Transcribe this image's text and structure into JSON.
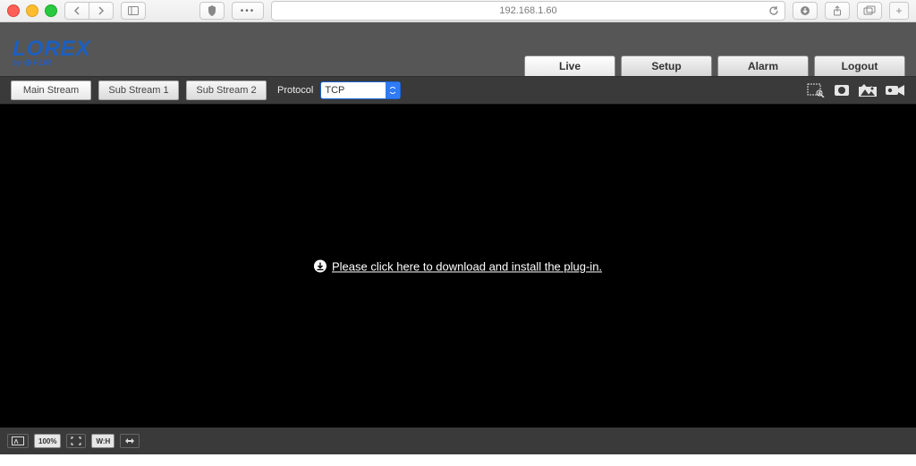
{
  "browser": {
    "url": "192.168.1.60"
  },
  "brand": {
    "name": "LOREX",
    "byline": "by",
    "sub": "FLIR"
  },
  "nav": {
    "live": "Live",
    "setup": "Setup",
    "alarm": "Alarm",
    "logout": "Logout"
  },
  "toolbar": {
    "main_stream": "Main Stream",
    "sub_stream_1": "Sub Stream 1",
    "sub_stream_2": "Sub Stream 2",
    "protocol_label": "Protocol",
    "protocol_value": "TCP"
  },
  "video": {
    "plugin_prompt": "Please click here to download and install the plug-in."
  },
  "bottom": {
    "zoom": "100%",
    "wh": "W:H"
  }
}
